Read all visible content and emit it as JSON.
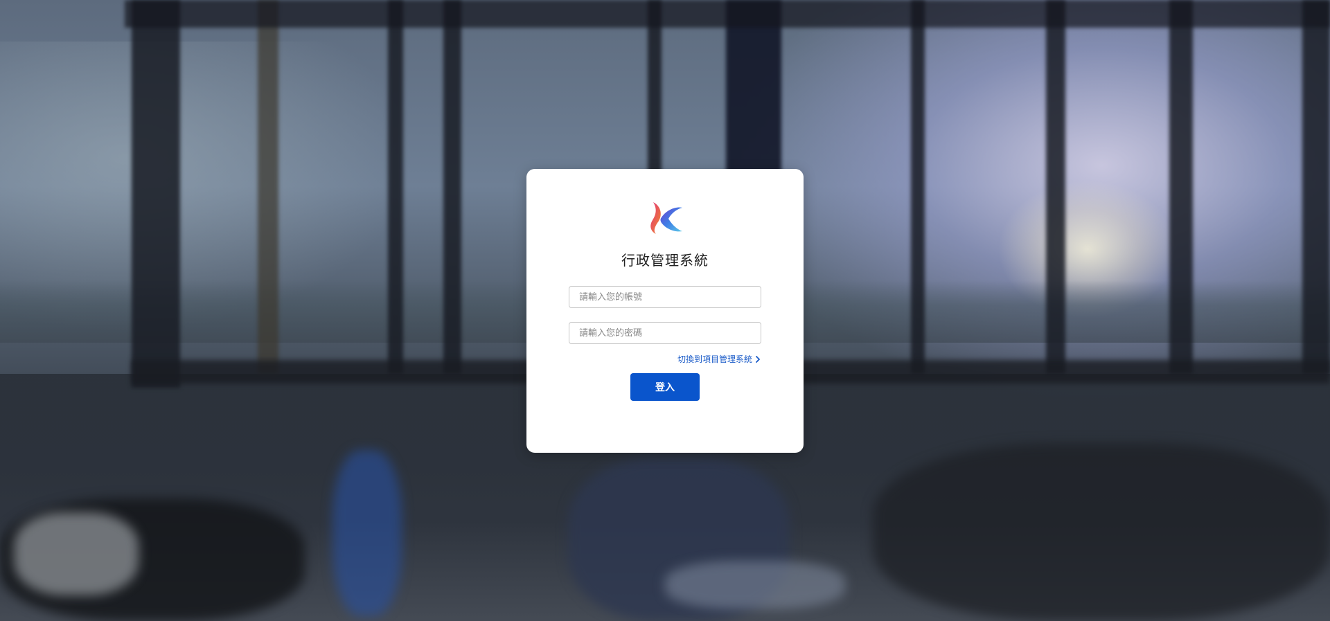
{
  "app": {
    "title": "行政管理系統"
  },
  "login": {
    "account_placeholder": "請輸入您的帳號",
    "password_placeholder": "請輸入您的密碼",
    "switch_label": "切換到項目管理系統",
    "submit_label": "登入"
  },
  "icons": {
    "logo": "brand-logo-icon",
    "switch_arrow": "chevron-right-icon"
  },
  "colors": {
    "primary": "#0a55cc",
    "link": "#1a5bc8",
    "card_background": "#ffffff"
  }
}
